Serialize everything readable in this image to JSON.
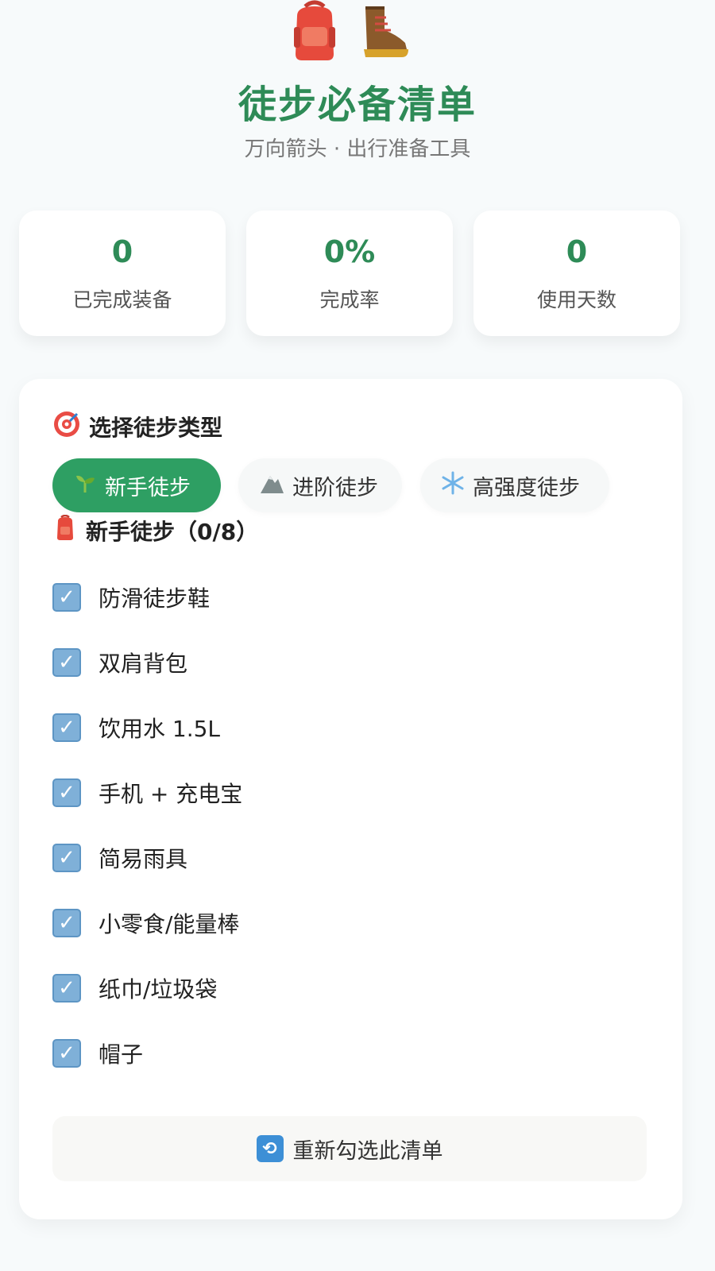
{
  "header": {
    "icons": [
      "backpack-icon",
      "hiking-boot-icon"
    ],
    "title": "徒步必备清单",
    "subtitle": "万向箭头 · 出行准备工具"
  },
  "stats": [
    {
      "value": "0",
      "label": "已完成装备"
    },
    {
      "value": "0%",
      "label": "完成率"
    },
    {
      "value": "0",
      "label": "使用天数"
    }
  ],
  "type_selector": {
    "title": "选择徒步类型",
    "icon": "target-icon",
    "options": [
      {
        "label": "新手徒步",
        "icon": "seedling-icon",
        "active": true
      },
      {
        "label": "进阶徒步",
        "icon": "mountain-icon",
        "active": false
      },
      {
        "label": "高强度徒步",
        "icon": "snowflake-icon",
        "active": false
      }
    ]
  },
  "checklist": {
    "header": "新手徒步（0/8）",
    "header_icon": "backpack-icon",
    "items": [
      {
        "label": "防滑徒步鞋",
        "checked": true
      },
      {
        "label": "双肩背包",
        "checked": true
      },
      {
        "label": "饮用水 1.5L",
        "checked": true
      },
      {
        "label": "手机 + 充电宝",
        "checked": true
      },
      {
        "label": "简易雨具",
        "checked": true
      },
      {
        "label": "小零食/能量棒",
        "checked": true
      },
      {
        "label": "纸巾/垃圾袋",
        "checked": true
      },
      {
        "label": "帽子",
        "checked": true
      }
    ]
  },
  "reset_button": {
    "label": "重新勾选此清单",
    "icon": "refresh-icon"
  },
  "colors": {
    "accent": "#2e8b57",
    "active_button": "#2e9f63",
    "checkbox": "#7fb0d8"
  }
}
